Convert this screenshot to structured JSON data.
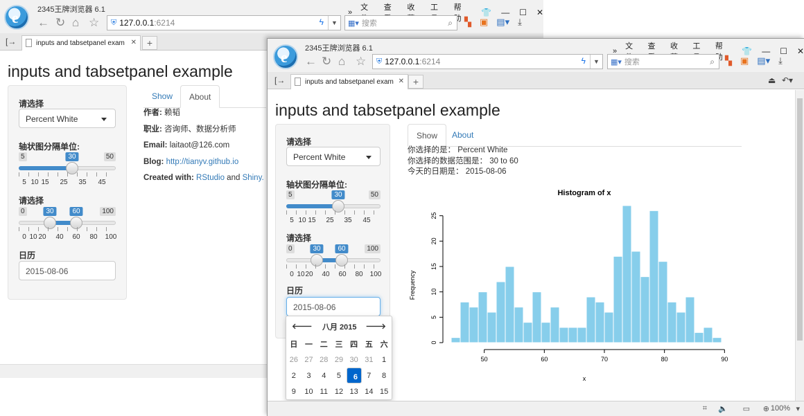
{
  "browser": {
    "app_title": "2345王牌浏览器 6.1",
    "menu": [
      "文件",
      "查看",
      "收藏",
      "工具",
      "帮助"
    ],
    "address_host": "127.0.0.1",
    "address_port": ":6214",
    "search_placeholder": "搜索",
    "tab_title": "inputs and tabsetpanel exam",
    "zoom": "100%"
  },
  "page": {
    "title": "inputs and tabsetpanel example",
    "select_label": "请选择",
    "select_value": "Percent White",
    "slider1_label": "轴状图分隔单位:",
    "slider1": {
      "min": "5",
      "max": "50",
      "value": "30",
      "ticks": [
        "5",
        "10",
        "15",
        "25",
        "35",
        "45"
      ]
    },
    "slider2_label": "请选择",
    "slider2": {
      "min": "0",
      "max": "100",
      "low": "30",
      "high": "60",
      "ticks": [
        "0",
        "10",
        "20",
        "40",
        "60",
        "80",
        "100"
      ]
    },
    "date_label": "日历",
    "date_value": "2015-08-06",
    "tabs": {
      "show": "Show",
      "about": "About"
    }
  },
  "about": {
    "author_label": "作者:",
    "author": "赖韬",
    "job_label": "职业:",
    "job": "咨询师、数据分析师",
    "email_label": "Email:",
    "email": "laitaot@126.com",
    "blog_label": "Blog:",
    "blog": "http://tianyv.github.io",
    "created_label": "Created with:",
    "created_r": "RStudio",
    "created_and": "and",
    "created_s": "Shiny."
  },
  "show": {
    "line1": "你选择的是： Percent White",
    "line2": "你选择的数据范围是： 30 to 60",
    "line3": "今天的日期是： 2015-08-06"
  },
  "calendar": {
    "title": "八月 2015",
    "weekdays": [
      "日",
      "一",
      "二",
      "三",
      "四",
      "五",
      "六"
    ],
    "rows": [
      [
        "26",
        "27",
        "28",
        "29",
        "30",
        "31",
        "1"
      ],
      [
        "2",
        "3",
        "4",
        "5",
        "6",
        "7",
        "8"
      ],
      [
        "9",
        "10",
        "11",
        "12",
        "13",
        "14",
        "15"
      ]
    ],
    "selected": "6"
  },
  "chart_data": {
    "type": "bar",
    "title": "Histogram of x",
    "xlabel": "x",
    "ylabel": "Frequency",
    "bin_width": 1.5,
    "x_start": 44.5,
    "values": [
      1,
      8,
      7,
      10,
      6,
      12,
      15,
      7,
      4,
      10,
      4,
      7,
      3,
      3,
      3,
      9,
      8,
      6,
      17,
      27,
      18,
      13,
      26,
      16,
      8,
      6,
      9,
      2,
      3,
      1
    ],
    "xticks": [
      50,
      60,
      70,
      80,
      90
    ],
    "yticks": [
      0,
      5,
      10,
      15,
      20,
      25
    ],
    "ylim": [
      0,
      27
    ],
    "xlim": [
      44.5,
      89.5
    ],
    "bar_color": "#87ceeb"
  }
}
